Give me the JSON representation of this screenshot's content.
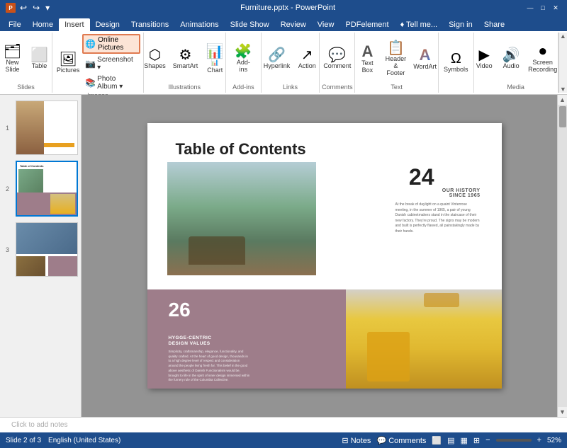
{
  "titleBar": {
    "title": "Furniture.pptx - PowerPoint",
    "icon": "P",
    "buttons": [
      "—",
      "□",
      "✕"
    ]
  },
  "quickAccess": {
    "buttons": [
      "↩",
      "↪",
      "⊞"
    ]
  },
  "menuTabs": {
    "items": [
      "File",
      "Home",
      "Insert",
      "Design",
      "Transitions",
      "Animations",
      "Slide Show",
      "Review",
      "View",
      "PDF element",
      "♦ Tell me...",
      "Sign in",
      "Share"
    ],
    "active": "Insert"
  },
  "ribbon": {
    "groups": [
      {
        "label": "Slides",
        "items": [
          {
            "icon": "🗂",
            "label": "New\nSlide"
          },
          {
            "icon": "⬜",
            "label": "Table"
          }
        ]
      },
      {
        "label": "Images",
        "items": [
          {
            "icon": "🖼",
            "label": "Pictures"
          },
          {
            "online_pictures": "Online Pictures"
          },
          {
            "screenshot": "Screenshot ▾"
          },
          {
            "photo_album": "Photo Album ▾"
          }
        ]
      },
      {
        "label": "Illustrations",
        "items": [
          {
            "icon": "⬡",
            "label": "Shapes"
          },
          {
            "icon": "⚙",
            "label": "SmartArt"
          },
          {
            "icon": "📊",
            "label": "Chart"
          }
        ]
      },
      {
        "label": "Add-ins",
        "items": [
          {
            "icon": "🧩",
            "label": "Add-\nins"
          }
        ]
      },
      {
        "label": "Links",
        "items": [
          {
            "icon": "🔗",
            "label": "Hyperlink"
          },
          {
            "icon": "↗",
            "label": "Action"
          }
        ]
      },
      {
        "label": "Comments",
        "items": [
          {
            "icon": "💬",
            "label": "Comment"
          }
        ]
      },
      {
        "label": "Text",
        "items": [
          {
            "icon": "A",
            "label": "Text\nBox"
          },
          {
            "icon": "📋",
            "label": "Header\n& Footer"
          },
          {
            "icon": "A",
            "label": "WordArt"
          }
        ]
      },
      {
        "label": "",
        "items": [
          {
            "icon": "Ω",
            "label": "Symbols"
          }
        ]
      },
      {
        "label": "Media",
        "items": [
          {
            "icon": "▶",
            "label": "Video"
          },
          {
            "icon": "🔊",
            "label": "Audio"
          },
          {
            "icon": "⏺",
            "label": "Screen\nRecording"
          }
        ]
      }
    ]
  },
  "slides": [
    {
      "number": "1",
      "active": false
    },
    {
      "number": "2",
      "active": true
    },
    {
      "number": "3",
      "active": false
    }
  ],
  "slideContent": {
    "title": "Table of Contents",
    "section1": {
      "number": "24",
      "heading1": "OUR HISTORY",
      "heading2": "SINCE 1965",
      "text": "At the break of daylight on a quaint Vinterrose meeting, in the summer of 1965, a pair of young Danish cabinetmakers stand in the staircase of their new factory. They're proud.\n\nThe signs may be modern and built is perfectly flawed, all painstakingly made by their hands."
    },
    "section2": {
      "number": "26",
      "heading1": "HYGGE-CENTRIC",
      "heading2": "DESIGN VALUES",
      "text": "Simplicity, craftsmanship, elegance, functionality, and quality crafted.\n\nAt the heart of good design, thousands in to a high degree level of respect and consideration around the people living fresh for.\n\nThis belief in the good above aesthetic of Danish Functionalism would be, brought to life in the spirit of inner design immersed within the furnery rule of the Columbia Collective."
    }
  },
  "statusBar": {
    "slideInfo": "Slide 2 of 3",
    "language": "English (United States)",
    "notesLabel": "⊟ Notes",
    "commentsLabel": "💬 Comments",
    "viewButtons": [
      "⬜",
      "▤",
      "▦",
      "⊞"
    ],
    "zoom": "52%"
  },
  "notesPlaceholder": "Click to add notes"
}
